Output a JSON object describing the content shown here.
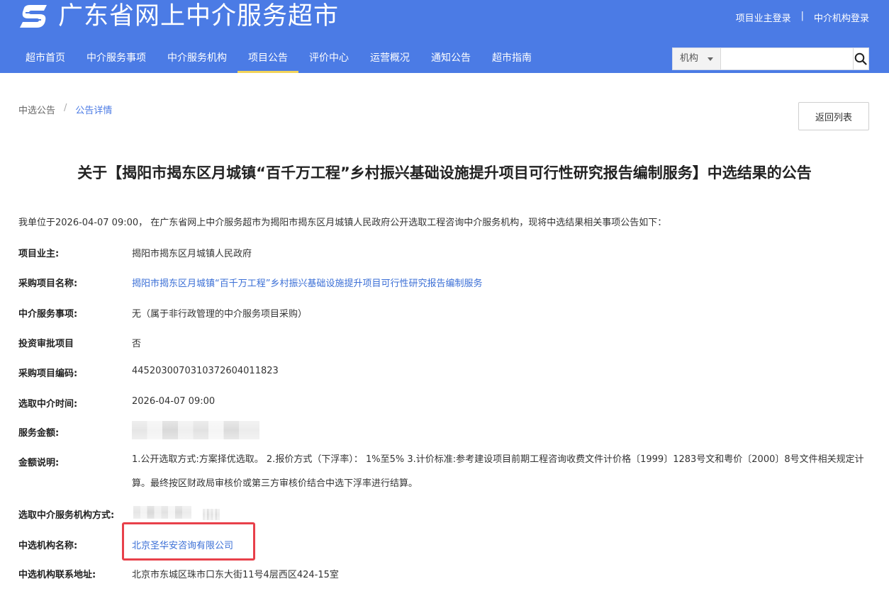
{
  "header": {
    "site_title": "广东省网上中介服务超市",
    "owner_login": "项目业主登录",
    "link_separator": "|",
    "agency_login": "中介机构登录"
  },
  "nav": {
    "items": [
      {
        "label": "超市首页"
      },
      {
        "label": "中介服务事项"
      },
      {
        "label": "中介服务机构"
      },
      {
        "label": "项目公告",
        "active": true
      },
      {
        "label": "评价中心"
      },
      {
        "label": "运营概况"
      },
      {
        "label": "通知公告"
      },
      {
        "label": "超市指南"
      }
    ]
  },
  "search": {
    "selected_option": "机构",
    "value": "",
    "placeholder": ""
  },
  "breadcrumb": {
    "parent": "中选公告",
    "separator": "/",
    "current": "公告详情"
  },
  "back_button": "返回列表",
  "announcement": {
    "title": "关于【揭阳市揭东区月城镇“百千万工程”乡村振兴基础设施提升项目可行性研究报告编制服务】中选结果的公告",
    "intro": "我单位于2026-04-07 09:00， 在广东省网上中介服务超市为揭阳市揭东区月城镇人民政府公开选取工程咨询中介服务机构，现将中选结果相关事项公告如下：",
    "fields": {
      "owner": {
        "label": "项目业主:",
        "value": "揭阳市揭东区月城镇人民政府"
      },
      "project_name": {
        "label": "采购项目名称:",
        "value": "揭阳市揭东区月城镇“百千万工程”乡村振兴基础设施提升项目可行性研究报告编制服务"
      },
      "service_item": {
        "label": "中介服务事项:",
        "value": "无（属于非行政管理的中介服务项目采购）"
      },
      "investment_approval": {
        "label": "投资审批项目",
        "value": "否"
      },
      "project_code": {
        "label": "采购项目编码:",
        "value": "4452030070310372604011823"
      },
      "selection_time": {
        "label": "选取中介时间:",
        "value": "2026-04-07 09:00"
      },
      "service_amount": {
        "label": "服务金额:"
      },
      "amount_note": {
        "label": "金额说明:",
        "value": "1.公开选取方式:方案择优选取。 2.报价方式（下浮率）： 1%至5% 3.计价标准:参考建设项目前期工程咨询收费文件计价格〔1999〕1283号文和粤价〔2000〕8号文件相关规定计算。最终按区财政局审核价或第三方审核价结合中选下浮率进行结算。"
      },
      "selection_method": {
        "label": "选取中介服务机构方式:"
      },
      "selected_agency": {
        "label": "中选机构名称:",
        "value": "北京圣华安咨询有限公司"
      },
      "agency_address": {
        "label": "中选机构联系地址:",
        "value": "北京市东城区珠市口东大街11号4层西区424-15室"
      }
    }
  },
  "colors": {
    "header_bg": "#4b7be5",
    "nav_active_underline": "#f2d45a",
    "link": "#3b6fd6",
    "highlight_box": "#e8404a"
  }
}
